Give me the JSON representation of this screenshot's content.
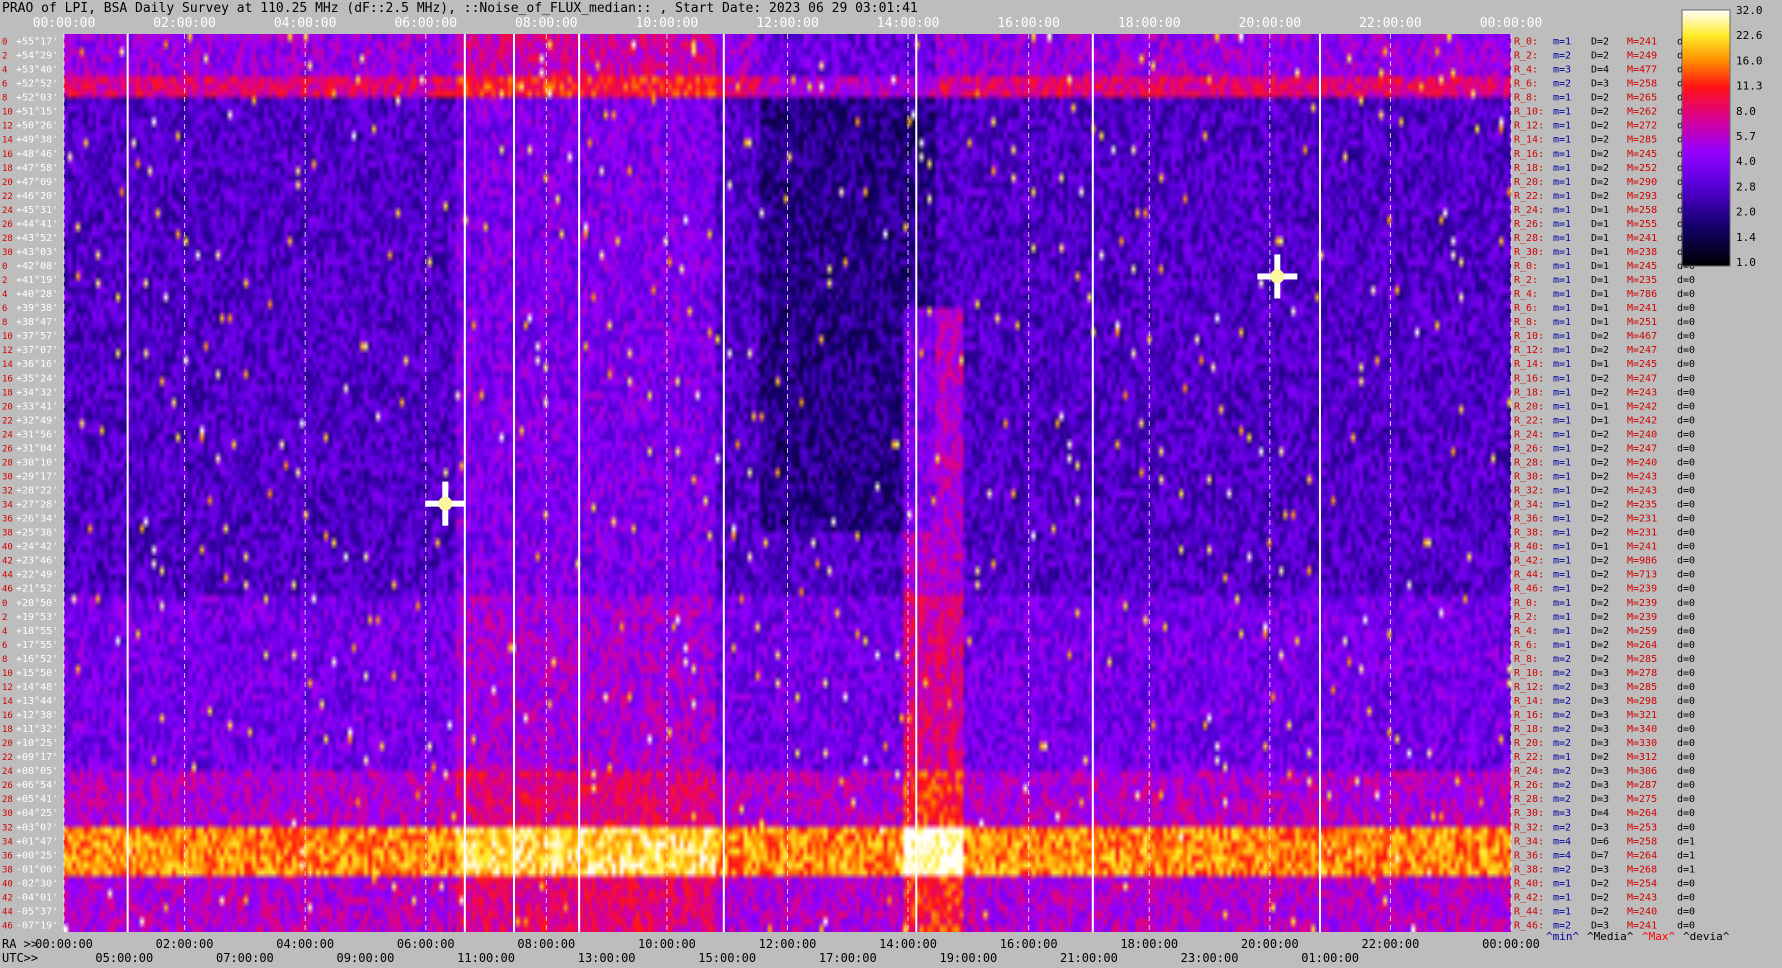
{
  "header": {
    "title": "PRAO of LPI, BSA Daily Survey at 110.25 MHz (dF::2.5 MHz), ::Noise_of_FLUX_median:: , Start Date: 2023 06 29 03:01:41"
  },
  "footer": {
    "ra_label": "RA >>",
    "utc_label": "UTC>>",
    "legend_keys": [
      {
        "text": "^min^",
        "color": "#0000a0"
      },
      {
        "text": "^Media^",
        "color": "#000000"
      },
      {
        "text": "^Max^",
        "color": "#ff0000"
      },
      {
        "text": "^devia^",
        "color": "#000000"
      }
    ]
  },
  "chart_data": {
    "type": "heatmap",
    "colormap": "black-blue-purple-red-yellow-white",
    "x_top_ticks": [
      "00:00:00",
      "02:00:00",
      "04:00:00",
      "06:00:00",
      "08:00:00",
      "10:00:00",
      "12:00:00",
      "14:00:00",
      "16:00:00",
      "18:00:00",
      "20:00:00",
      "22:00:00",
      "00:00:00"
    ],
    "x_bottom_ra_ticks": [
      "00:00:00",
      "02:00:00",
      "04:00:00",
      "06:00:00",
      "08:00:00",
      "10:00:00",
      "12:00:00",
      "14:00:00",
      "16:00:00",
      "18:00:00",
      "20:00:00",
      "22:00:00",
      "00:00:00"
    ],
    "x_bottom_utc_ticks": [
      "05:00:00",
      "07:00:00",
      "09:00:00",
      "11:00:00",
      "13:00:00",
      "15:00:00",
      "17:00:00",
      "19:00:00",
      "21:00:00",
      "23:00:00",
      "01:00:00"
    ],
    "y_declination_ticks": [
      "+55°17'",
      "+54°29'",
      "+53°40'",
      "+52°52'",
      "+52°03'",
      "+51°15'",
      "+50°26'",
      "+49°38'",
      "+48°46'",
      "+47°58'",
      "+47°09'",
      "+46°20'",
      "+45°31'",
      "+44°41'",
      "+43°52'",
      "+43°03'",
      "+42°08'",
      "+41°19'",
      "+40°28'",
      "+39°38'",
      "+38°47'",
      "+37°57'",
      "+37°07'",
      "+36°16'",
      "+35°24'",
      "+34°32'",
      "+33°41'",
      "+32°49'",
      "+31°56'",
      "+31°04'",
      "+30°10'",
      "+29°17'",
      "+28°22'",
      "+27°28'",
      "+26°34'",
      "+25°38'",
      "+24°42'",
      "+23°46'",
      "+22°49'",
      "+21°52'",
      "+20°50'",
      "+19°53'",
      "+18°55'",
      "+17°55'",
      "+16°52'",
      "+15°50'",
      "+14°48'",
      "+13°44'",
      "+12°38'",
      "+11°32'",
      "+10°25'",
      "+09°17'",
      "+08°05'",
      "+06°54'",
      "+05°41'",
      "+04°25'",
      "+03°07'",
      "+01°47'",
      "+00°25'",
      "-01°00'",
      "-02°30'",
      "-04°01'",
      "-05°37'",
      "-07°19'"
    ],
    "y_beam_index": [
      "0",
      "2",
      "4",
      "6",
      "8",
      "10",
      "12",
      "14",
      "16",
      "18",
      "20",
      "22",
      "24",
      "26",
      "28",
      "30",
      "0",
      "2",
      "4",
      "6",
      "8",
      "10",
      "12",
      "14",
      "16",
      "18",
      "20",
      "22",
      "24",
      "26",
      "28",
      "30",
      "32",
      "34",
      "36",
      "38",
      "40",
      "42",
      "44",
      "46",
      "0",
      "2",
      "4",
      "6",
      "8",
      "10",
      "12",
      "14",
      "16",
      "18",
      "20",
      "22",
      "24",
      "26",
      "28",
      "30",
      "32",
      "34",
      "36",
      "38",
      "40",
      "42",
      "44",
      "46"
    ],
    "colorbar": {
      "ticks": [
        "32.0",
        "22.6",
        "16.0",
        "11.3",
        "8.0",
        "5.7",
        "4.0",
        "2.8",
        "2.0",
        "1.4",
        "1.0"
      ],
      "scale": "log",
      "range": [
        1.0,
        32.0
      ]
    },
    "right_stats": [
      {
        "r": "R_0:",
        "m": "1",
        "d": "2",
        "M": "241",
        "dev": "0"
      },
      {
        "r": "R_2:",
        "m": "2",
        "d": "2",
        "M": "249",
        "dev": "0"
      },
      {
        "r": "R_4:",
        "m": "3",
        "d": "4",
        "M": "477",
        "dev": "0"
      },
      {
        "r": "R_6:",
        "m": "2",
        "d": "3",
        "M": "258",
        "dev": "0"
      },
      {
        "r": "R_8:",
        "m": "1",
        "d": "2",
        "M": "265",
        "dev": "0"
      },
      {
        "r": "R_10:",
        "m": "1",
        "d": "2",
        "M": "262",
        "dev": ""
      },
      {
        "r": "R_12:",
        "m": "1",
        "d": "2",
        "M": "272",
        "dev": ""
      },
      {
        "r": "R_14:",
        "m": "1",
        "d": "2",
        "M": "285",
        "dev": ""
      },
      {
        "r": "R_16:",
        "m": "1",
        "d": "2",
        "M": "245",
        "dev": ""
      },
      {
        "r": "R_18:",
        "m": "1",
        "d": "2",
        "M": "252",
        "dev": ""
      },
      {
        "r": "R_20:",
        "m": "1",
        "d": "2",
        "M": "290",
        "dev": ""
      },
      {
        "r": "R_22:",
        "m": "1",
        "d": "2",
        "M": "293",
        "dev": ""
      },
      {
        "r": "R_24:",
        "m": "1",
        "d": "1",
        "M": "258",
        "dev": ""
      },
      {
        "r": "R_26:",
        "m": "1",
        "d": "1",
        "M": "255",
        "dev": ""
      },
      {
        "r": "R_28:",
        "m": "1",
        "d": "1",
        "M": "241",
        "dev": ""
      },
      {
        "r": "R_30:",
        "m": "1",
        "d": "1",
        "M": "238",
        "dev": ""
      },
      {
        "r": "R_0:",
        "m": "1",
        "d": "1",
        "M": "245",
        "dev": "0"
      },
      {
        "r": "R_2:",
        "m": "1",
        "d": "1",
        "M": "235",
        "dev": "0"
      },
      {
        "r": "R_4:",
        "m": "1",
        "d": "1",
        "M": "786",
        "dev": "0"
      },
      {
        "r": "R_6:",
        "m": "1",
        "d": "1",
        "M": "241",
        "dev": "0"
      },
      {
        "r": "R_8:",
        "m": "1",
        "d": "1",
        "M": "251",
        "dev": "0"
      },
      {
        "r": "R_10:",
        "m": "1",
        "d": "2",
        "M": "467",
        "dev": "0"
      },
      {
        "r": "R_12:",
        "m": "1",
        "d": "2",
        "M": "247",
        "dev": "0"
      },
      {
        "r": "R_14:",
        "m": "1",
        "d": "1",
        "M": "245",
        "dev": "0"
      },
      {
        "r": "R_16:",
        "m": "1",
        "d": "2",
        "M": "247",
        "dev": "0"
      },
      {
        "r": "R_18:",
        "m": "1",
        "d": "2",
        "M": "243",
        "dev": "0"
      },
      {
        "r": "R_20:",
        "m": "1",
        "d": "1",
        "M": "242",
        "dev": "0"
      },
      {
        "r": "R_22:",
        "m": "1",
        "d": "1",
        "M": "242",
        "dev": "0"
      },
      {
        "r": "R_24:",
        "m": "1",
        "d": "2",
        "M": "240",
        "dev": "0"
      },
      {
        "r": "R_26:",
        "m": "1",
        "d": "2",
        "M": "247",
        "dev": "0"
      },
      {
        "r": "R_28:",
        "m": "1",
        "d": "2",
        "M": "240",
        "dev": "0"
      },
      {
        "r": "R_30:",
        "m": "1",
        "d": "2",
        "M": "243",
        "dev": "0"
      },
      {
        "r": "R_32:",
        "m": "1",
        "d": "2",
        "M": "243",
        "dev": "0"
      },
      {
        "r": "R_34:",
        "m": "1",
        "d": "2",
        "M": "235",
        "dev": "0"
      },
      {
        "r": "R_36:",
        "m": "1",
        "d": "2",
        "M": "231",
        "dev": "0"
      },
      {
        "r": "R_38:",
        "m": "1",
        "d": "2",
        "M": "231",
        "dev": "0"
      },
      {
        "r": "R_40:",
        "m": "1",
        "d": "1",
        "M": "241",
        "dev": "0"
      },
      {
        "r": "R_42:",
        "m": "1",
        "d": "2",
        "M": "986",
        "dev": "0"
      },
      {
        "r": "R_44:",
        "m": "1",
        "d": "2",
        "M": "713",
        "dev": "0"
      },
      {
        "r": "R_46:",
        "m": "1",
        "d": "2",
        "M": "239",
        "dev": "0"
      },
      {
        "r": "R_0:",
        "m": "1",
        "d": "2",
        "M": "239",
        "dev": "0"
      },
      {
        "r": "R_2:",
        "m": "1",
        "d": "2",
        "M": "239",
        "dev": "0"
      },
      {
        "r": "R_4:",
        "m": "1",
        "d": "2",
        "M": "259",
        "dev": "0"
      },
      {
        "r": "R_6:",
        "m": "1",
        "d": "2",
        "M": "264",
        "dev": "0"
      },
      {
        "r": "R_8:",
        "m": "2",
        "d": "2",
        "M": "285",
        "dev": "0"
      },
      {
        "r": "R_10:",
        "m": "2",
        "d": "3",
        "M": "278",
        "dev": "0"
      },
      {
        "r": "R_12:",
        "m": "2",
        "d": "3",
        "M": "285",
        "dev": "0"
      },
      {
        "r": "R_14:",
        "m": "2",
        "d": "3",
        "M": "298",
        "dev": "0"
      },
      {
        "r": "R_16:",
        "m": "2",
        "d": "3",
        "M": "321",
        "dev": "0"
      },
      {
        "r": "R_18:",
        "m": "2",
        "d": "3",
        "M": "340",
        "dev": "0"
      },
      {
        "r": "R_20:",
        "m": "2",
        "d": "3",
        "M": "330",
        "dev": "0"
      },
      {
        "r": "R_22:",
        "m": "1",
        "d": "2",
        "M": "312",
        "dev": "0"
      },
      {
        "r": "R_24:",
        "m": "2",
        "d": "3",
        "M": "306",
        "dev": "0"
      },
      {
        "r": "R_26:",
        "m": "2",
        "d": "3",
        "M": "287",
        "dev": "0"
      },
      {
        "r": "R_28:",
        "m": "2",
        "d": "3",
        "M": "275",
        "dev": "0"
      },
      {
        "r": "R_30:",
        "m": "3",
        "d": "4",
        "M": "264",
        "dev": "0"
      },
      {
        "r": "R_32:",
        "m": "2",
        "d": "3",
        "M": "253",
        "dev": "0"
      },
      {
        "r": "R_34:",
        "m": "4",
        "d": "6",
        "M": "258",
        "dev": "1"
      },
      {
        "r": "R_36:",
        "m": "4",
        "d": "7",
        "M": "264",
        "dev": "1"
      },
      {
        "r": "R_38:",
        "m": "2",
        "d": "3",
        "M": "268",
        "dev": "1"
      },
      {
        "r": "R_40:",
        "m": "1",
        "d": "2",
        "M": "254",
        "dev": "0"
      },
      {
        "r": "R_42:",
        "m": "1",
        "d": "2",
        "M": "243",
        "dev": "0"
      },
      {
        "r": "R_44:",
        "m": "1",
        "d": "2",
        "M": "240",
        "dev": "0"
      },
      {
        "r": "R_46:",
        "m": "2",
        "d": "3",
        "M": "241",
        "dev": "0"
      }
    ]
  }
}
